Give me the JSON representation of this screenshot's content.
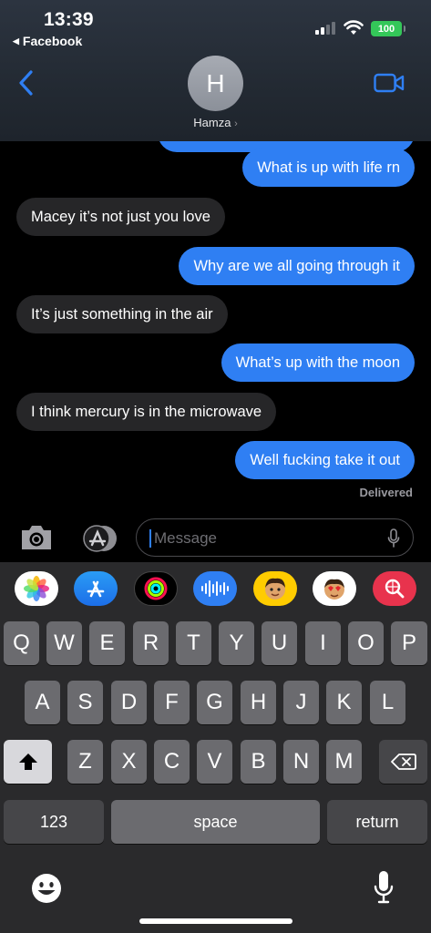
{
  "status_bar": {
    "time": "13:39",
    "back_app": "Facebook",
    "battery": "100"
  },
  "header": {
    "avatar_initial": "H",
    "contact_name": "Hamza"
  },
  "messages": [
    {
      "side": "out",
      "text": "What is up with life rn"
    },
    {
      "side": "in",
      "text": "Macey it’s not just you love"
    },
    {
      "side": "out",
      "text": "Why are we all going through it"
    },
    {
      "side": "in",
      "text": "It’s just something in the air"
    },
    {
      "side": "out",
      "text": "What’s up with the moon"
    },
    {
      "side": "in",
      "text": "I think mercury is in the microwave"
    },
    {
      "side": "out",
      "text": "Well fucking take it out"
    }
  ],
  "delivery_status": "Delivered",
  "composer": {
    "placeholder": "Message"
  },
  "app_drawer": [
    "photos-icon",
    "app-store-icon",
    "activity-icon",
    "audio-message-icon",
    "memoji-icon",
    "memoji-stickers-icon",
    "web-search-icon"
  ],
  "keyboard": {
    "row1": [
      "Q",
      "W",
      "E",
      "R",
      "T",
      "Y",
      "U",
      "I",
      "O",
      "P"
    ],
    "row2": [
      "A",
      "S",
      "D",
      "F",
      "G",
      "H",
      "J",
      "K",
      "L"
    ],
    "row3": [
      "Z",
      "X",
      "C",
      "V",
      "B",
      "N",
      "M"
    ],
    "numbers_label": "123",
    "space_label": "space",
    "return_label": "return"
  },
  "colors": {
    "outgoing": "#2f7ff3",
    "incoming": "#262628",
    "battery": "#34c759",
    "accent": "#2f7ff3"
  }
}
